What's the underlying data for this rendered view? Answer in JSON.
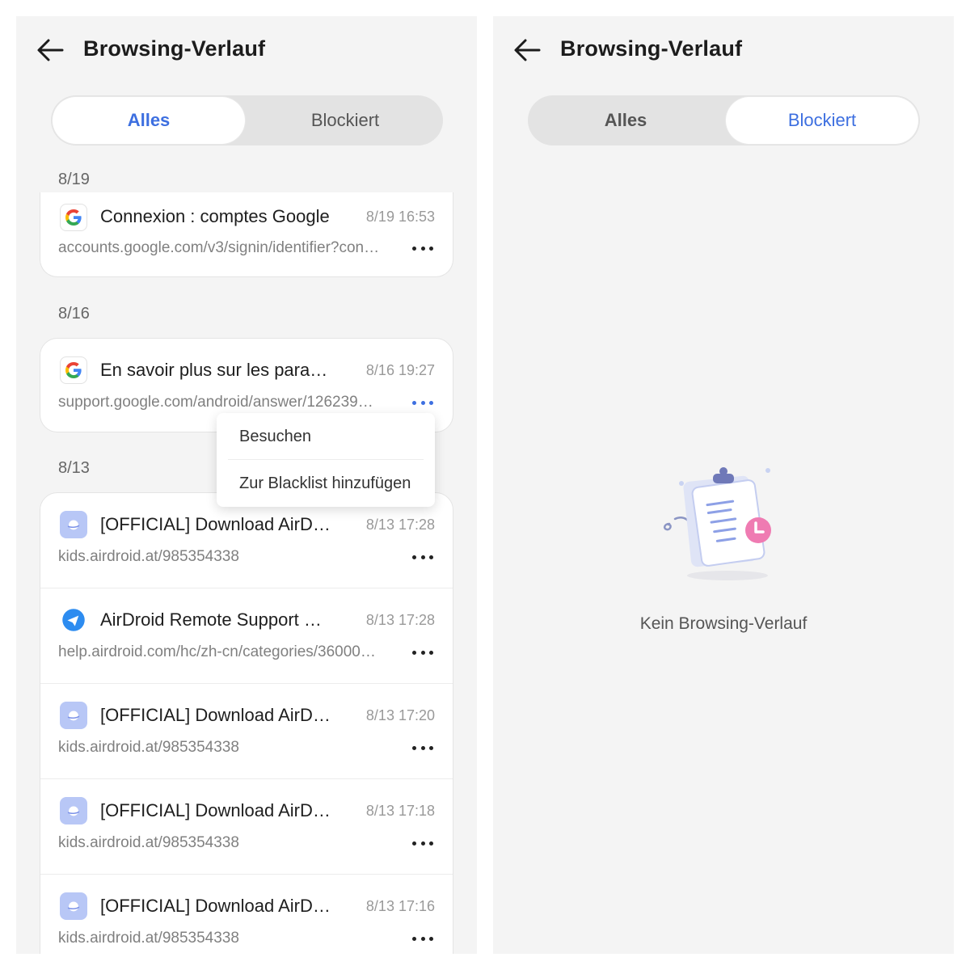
{
  "header": {
    "title": "Browsing-Verlauf"
  },
  "tabs": {
    "all": "Alles",
    "blocked": "Blockiert"
  },
  "groups": [
    {
      "date": "8/19"
    },
    {
      "date": "8/16"
    },
    {
      "date": "8/13"
    }
  ],
  "items": [
    {
      "title": "Connexion : comptes Google",
      "time": "8/19 16:53",
      "url": "accounts.google.com/v3/signin/identifier?con…",
      "icon": "google-icon"
    },
    {
      "title": "En savoir plus sur les para…",
      "time": "8/16 19:27",
      "url": "support.google.com/android/answer/126239…",
      "icon": "google-icon"
    },
    {
      "title": "[OFFICIAL] Download AirD…",
      "time": "8/13 17:28",
      "url": "kids.airdroid.at/985354338",
      "icon": "airdroid-kids-icon"
    },
    {
      "title": "AirDroid Remote Support …",
      "time": "8/13 17:28",
      "url": "help.airdroid.com/hc/zh-cn/categories/36000…",
      "icon": "airdroid-remote-icon"
    },
    {
      "title": "[OFFICIAL] Download AirD…",
      "time": "8/13 17:20",
      "url": "kids.airdroid.at/985354338",
      "icon": "airdroid-kids-icon"
    },
    {
      "title": "[OFFICIAL] Download AirD…",
      "time": "8/13 17:18",
      "url": "kids.airdroid.at/985354338",
      "icon": "airdroid-kids-icon"
    },
    {
      "title": "[OFFICIAL] Download AirD…",
      "time": "8/13 17:16",
      "url": "kids.airdroid.at/985354338",
      "icon": "airdroid-kids-icon"
    }
  ],
  "context_menu": {
    "visit": "Besuchen",
    "blacklist": "Zur Blacklist hinzufügen"
  },
  "empty": {
    "message": "Kein Browsing-Verlauf"
  },
  "colors": {
    "accent": "#3d6fe0",
    "background": "#f4f4f4",
    "card": "#ffffff"
  }
}
